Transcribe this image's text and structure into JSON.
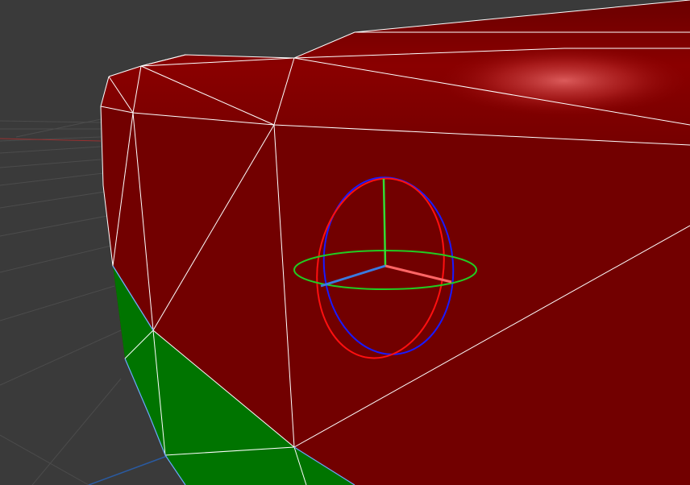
{
  "viewport": {
    "background_color": "#3a3a3a",
    "grid_color": "#4a4a4a",
    "x_axis_color": "#9a3030",
    "z_axis_color": "#2a5aa0"
  },
  "mesh": {
    "face_color": "#7a0000",
    "face_highlight_color": "#d85050",
    "selected_face_color": "#007400",
    "wire_color": "#ffffff",
    "selected_edge_color": "#6aa8ff",
    "selection_mode": "face"
  },
  "rotate_gizmo": {
    "tool": "rotate",
    "x_ring_color": "#ff1010",
    "y_ring_color": "#22cc22",
    "z_ring_color": "#1a1aff",
    "x_axis_color": "#ff6666",
    "y_axis_color": "#33dd33",
    "z_axis_color": "#3a7ae0",
    "icons": [
      "rotate-x-ring",
      "rotate-y-ring",
      "rotate-z-ring"
    ]
  }
}
